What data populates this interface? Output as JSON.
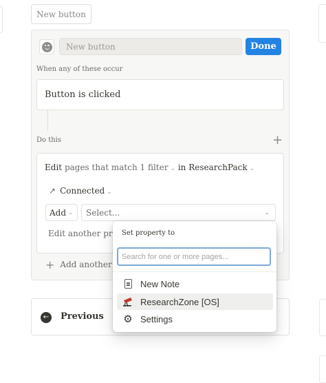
{
  "top": {
    "new_button_label": "New button"
  },
  "editor": {
    "name_placeholder": "New button",
    "done_label": "Done",
    "when_label": "When any of these occur",
    "trigger": "Button is clicked",
    "do_this_label": "Do this",
    "action": {
      "verb": "Edit",
      "filter_text": "pages that match 1 filter",
      "in_word": "in",
      "database": "ResearchPack",
      "property": "Connected",
      "add_label": "Add",
      "select_placeholder": "Select...",
      "edit_another": "Edit another prop",
      "add_another": "Add another"
    }
  },
  "previous": {
    "label": "Previous"
  },
  "popup": {
    "title": "Set property to",
    "search_placeholder": "Search for one or more pages...",
    "items": [
      {
        "label": "New Note",
        "icon": "page-icon"
      },
      {
        "label": "ResearchZone [OS]",
        "icon": "telescope-icon",
        "highlighted": true
      },
      {
        "label": "Settings",
        "icon": "gear-icon"
      }
    ]
  }
}
